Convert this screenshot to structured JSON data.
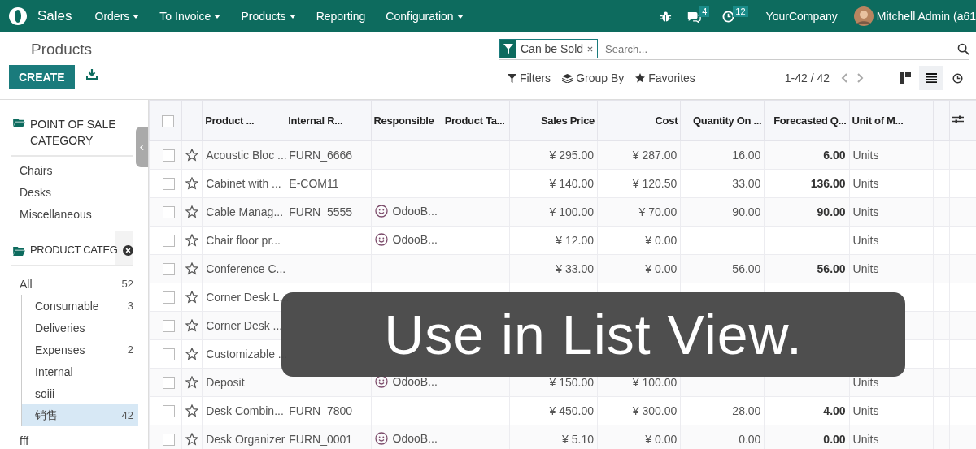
{
  "navbar": {
    "app": "Sales",
    "menus": [
      {
        "label": "Orders",
        "dropdown": true
      },
      {
        "label": "To Invoice",
        "dropdown": true
      },
      {
        "label": "Products",
        "dropdown": true
      },
      {
        "label": "Reporting",
        "dropdown": false
      },
      {
        "label": "Configuration",
        "dropdown": true
      }
    ],
    "messages_count": "4",
    "activities_count": "12",
    "company": "YourCompany",
    "user": "Mitchell Admin (a61"
  },
  "control_panel": {
    "title": "Products",
    "create": "CREATE",
    "facet": "Can be Sold",
    "search_placeholder": "Search...",
    "filters": "Filters",
    "group_by": "Group By",
    "favorites": "Favorites",
    "pager": "1-42 / 42",
    "views": [
      {
        "kind": "kanban",
        "selected": false
      },
      {
        "kind": "list",
        "selected": true
      },
      {
        "kind": "activity",
        "selected": false
      }
    ]
  },
  "sidebar": {
    "pos_title": "POINT OF SALE CATEGORY",
    "pos_items": [
      {
        "label": "Chairs"
      },
      {
        "label": "Desks"
      },
      {
        "label": "Miscellaneous"
      }
    ],
    "category_title": "PRODUCT CATEG",
    "categories": [
      {
        "label": "All",
        "count": "52",
        "selected": false,
        "children": [
          {
            "label": "Consumable",
            "count": "3",
            "selected": false
          },
          {
            "label": "Deliveries",
            "selected": false
          },
          {
            "label": "Expenses",
            "count": "2",
            "selected": false
          },
          {
            "label": "Internal",
            "selected": false
          },
          {
            "label": "soiii",
            "selected": false
          },
          {
            "label": "销售",
            "count": "42",
            "selected": true
          }
        ]
      },
      {
        "label": "fff",
        "selected": false
      }
    ]
  },
  "table": {
    "all_checked": false,
    "columns": [
      "Product ...",
      "Internal R...",
      "Responsible",
      "Product Ta...",
      "Sales Price",
      "Cost",
      "Quantity On ...",
      "Forecasted Q...",
      "Unit of M..."
    ],
    "rows": [
      {
        "checked": false,
        "name": "Acoustic Bloc ...",
        "ref": "FURN_6666",
        "price": "¥ 295.00",
        "cost": "¥ 287.00",
        "qty": "16.00",
        "forecast": "6.00",
        "uom": "Units"
      },
      {
        "checked": false,
        "name": "Cabinet with ...",
        "ref": "E-COM11",
        "price": "¥ 140.00",
        "cost": "¥ 120.50",
        "qty": "33.00",
        "forecast": "136.00",
        "uom": "Units"
      },
      {
        "checked": false,
        "name": "Cable Manag...",
        "ref": "FURN_5555",
        "responsible": "OdooB...",
        "price": "¥ 100.00",
        "cost": "¥ 70.00",
        "qty": "90.00",
        "forecast": "90.00",
        "uom": "Units"
      },
      {
        "checked": false,
        "name": "Chair floor pr...",
        "responsible": "OdooB...",
        "price": "¥ 12.00",
        "cost": "¥ 0.00",
        "uom": "Units"
      },
      {
        "checked": false,
        "name": "Conference C...",
        "price": "¥ 33.00",
        "cost": "¥ 0.00",
        "qty": "56.00",
        "forecast": "56.00",
        "uom": "Units"
      },
      {
        "checked": false,
        "name": "Corner Desk L..."
      },
      {
        "checked": false,
        "name": "Corner Desk ..."
      },
      {
        "checked": false,
        "name": "Customizable ..."
      },
      {
        "checked": false,
        "name": "Deposit",
        "responsible": "OdooB...",
        "price": "¥ 150.00",
        "cost": "¥ 100.00",
        "uom": "Units"
      },
      {
        "checked": false,
        "name": "Desk Combin...",
        "ref": "FURN_7800",
        "price": "¥ 450.00",
        "cost": "¥ 300.00",
        "qty": "28.00",
        "forecast": "4.00",
        "uom": "Units"
      },
      {
        "checked": false,
        "name": "Desk Organizer",
        "ref": "FURN_0001",
        "responsible": "OdooB...",
        "price": "¥ 5.10",
        "cost": "¥ 0.00",
        "qty": "0.00",
        "forecast": "0.00",
        "uom": "Units"
      }
    ]
  },
  "caption": "Use in List View."
}
